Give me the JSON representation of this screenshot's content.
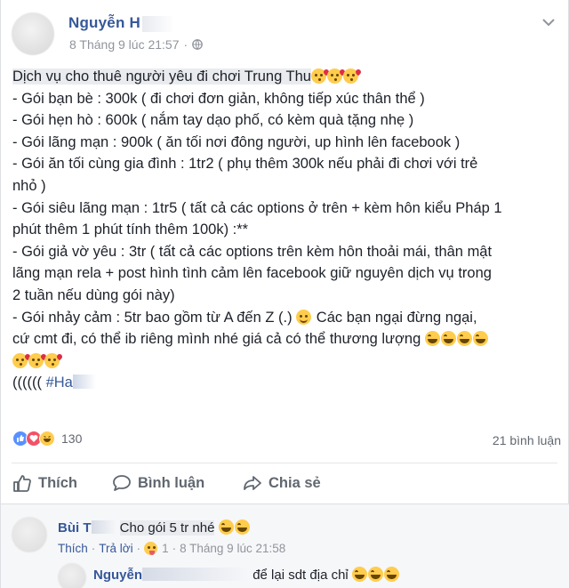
{
  "post": {
    "author": "Nguyễn H",
    "timestamp": "8 Tháng 9 lúc 21:57",
    "privacy_separator": "·",
    "lines": {
      "l1": "Dịch vụ cho thuê người yêu đi chơi Trung Thu",
      "l2": "- Gói bạn bè : 300k ( đi chơi đơn giản, không tiếp xúc thân thể )",
      "l3": "- Gói hẹn hò : 600k ( nắm tay dạo phố, có kèm quà tặng nhẹ )",
      "l4": "- Gói lãng mạn : 900k ( ăn tối nơi đông người, up hình lên facebook )",
      "l5": "- Gói ăn tối cùng gia đình : 1tr2 ( phụ thêm 300k nếu phải đi chơi với trẻ",
      "l6": "nhỏ )",
      "l7": "- Gói siêu lãng mạn : 1tr5 ( tất cả các options ở trên + kèm hôn kiểu Pháp 1",
      "l8": "phút thêm 1 phút tính thêm 100k) :**",
      "l9": "- Gói giả vờ yêu : 3tr ( tất cả các options trên kèm hôn thoải mái, thân mật",
      "l10": "lãng mạn rela + post hình tình cảm lên facebook giữ nguyên dịch vụ trong",
      "l11": "2 tuần nếu dùng gói này)",
      "l12a": "- Gói nhảy cảm : 5tr bao gồm từ A đến Z (.)",
      "l12b": "Các bạn ngại đừng ngại,",
      "l13": "cứ cmt đi, có thể ib riêng mình nhé giá cả có thể thương lượng",
      "l15a": "(((((( ",
      "l15b": "#Ha"
    }
  },
  "reactions": {
    "count": "130",
    "comments_count": "21 bình luận"
  },
  "actions": {
    "like": "Thích",
    "comment": "Bình luận",
    "share": "Chia sẻ"
  },
  "comments": [
    {
      "author": "Bùi T",
      "text": "Cho gói 5 tr nhé",
      "like_label": "Thích",
      "reply_label": "Trả lời",
      "reaction_count": "1",
      "timestamp": "8 Tháng 9 lúc 21:58",
      "dot": "·"
    },
    {
      "author": "Nguyễn",
      "text": "để lại sdt địa chỉ"
    }
  ],
  "colors": {
    "link_blue": "#365899",
    "meta_grey": "#90949c",
    "text": "#1d2129",
    "like_blue": "#5890ff",
    "love_red": "#f25268",
    "haha_yellow": "#ffcc4d"
  }
}
